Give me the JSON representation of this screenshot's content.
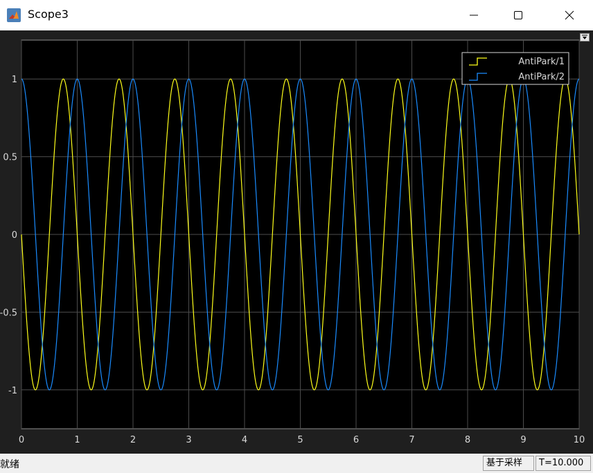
{
  "window": {
    "title": "Scope3",
    "minimize_icon": "minimize-icon",
    "maximize_icon": "maximize-icon",
    "close_icon": "close-icon",
    "app_icon": "matlab-icon"
  },
  "status": {
    "state": "就绪",
    "mode": "基于采样",
    "time": "T=10.000"
  },
  "colors": {
    "plot_bg": "#000000",
    "frame_bg": "#1f1f1f",
    "grid": "#4d4d4d",
    "axis_text": "#d9d9d9",
    "series1": "#ffff1a",
    "series2": "#1a8cff"
  },
  "chart_data": {
    "type": "line",
    "title": "",
    "xlabel": "",
    "ylabel": "",
    "xlim": [
      0,
      10
    ],
    "ylim": [
      -1.25,
      1.25
    ],
    "x_ticks": [
      "0",
      "1",
      "2",
      "3",
      "4",
      "5",
      "6",
      "7",
      "8",
      "9",
      "10"
    ],
    "y_ticks": [
      "1",
      "0.5",
      "0",
      "-0.5",
      "-1"
    ],
    "y_tick_values": [
      1,
      0.5,
      0,
      -0.5,
      -1
    ],
    "grid": true,
    "legend_position": "top-right",
    "frequency_hz": 1,
    "series": [
      {
        "name": "AntiPark/1",
        "function": "-sin(2*pi*t)",
        "color": "#ffff1a"
      },
      {
        "name": "AntiPark/2",
        "function": "cos(2*pi*t)",
        "color": "#1a8cff"
      }
    ]
  }
}
